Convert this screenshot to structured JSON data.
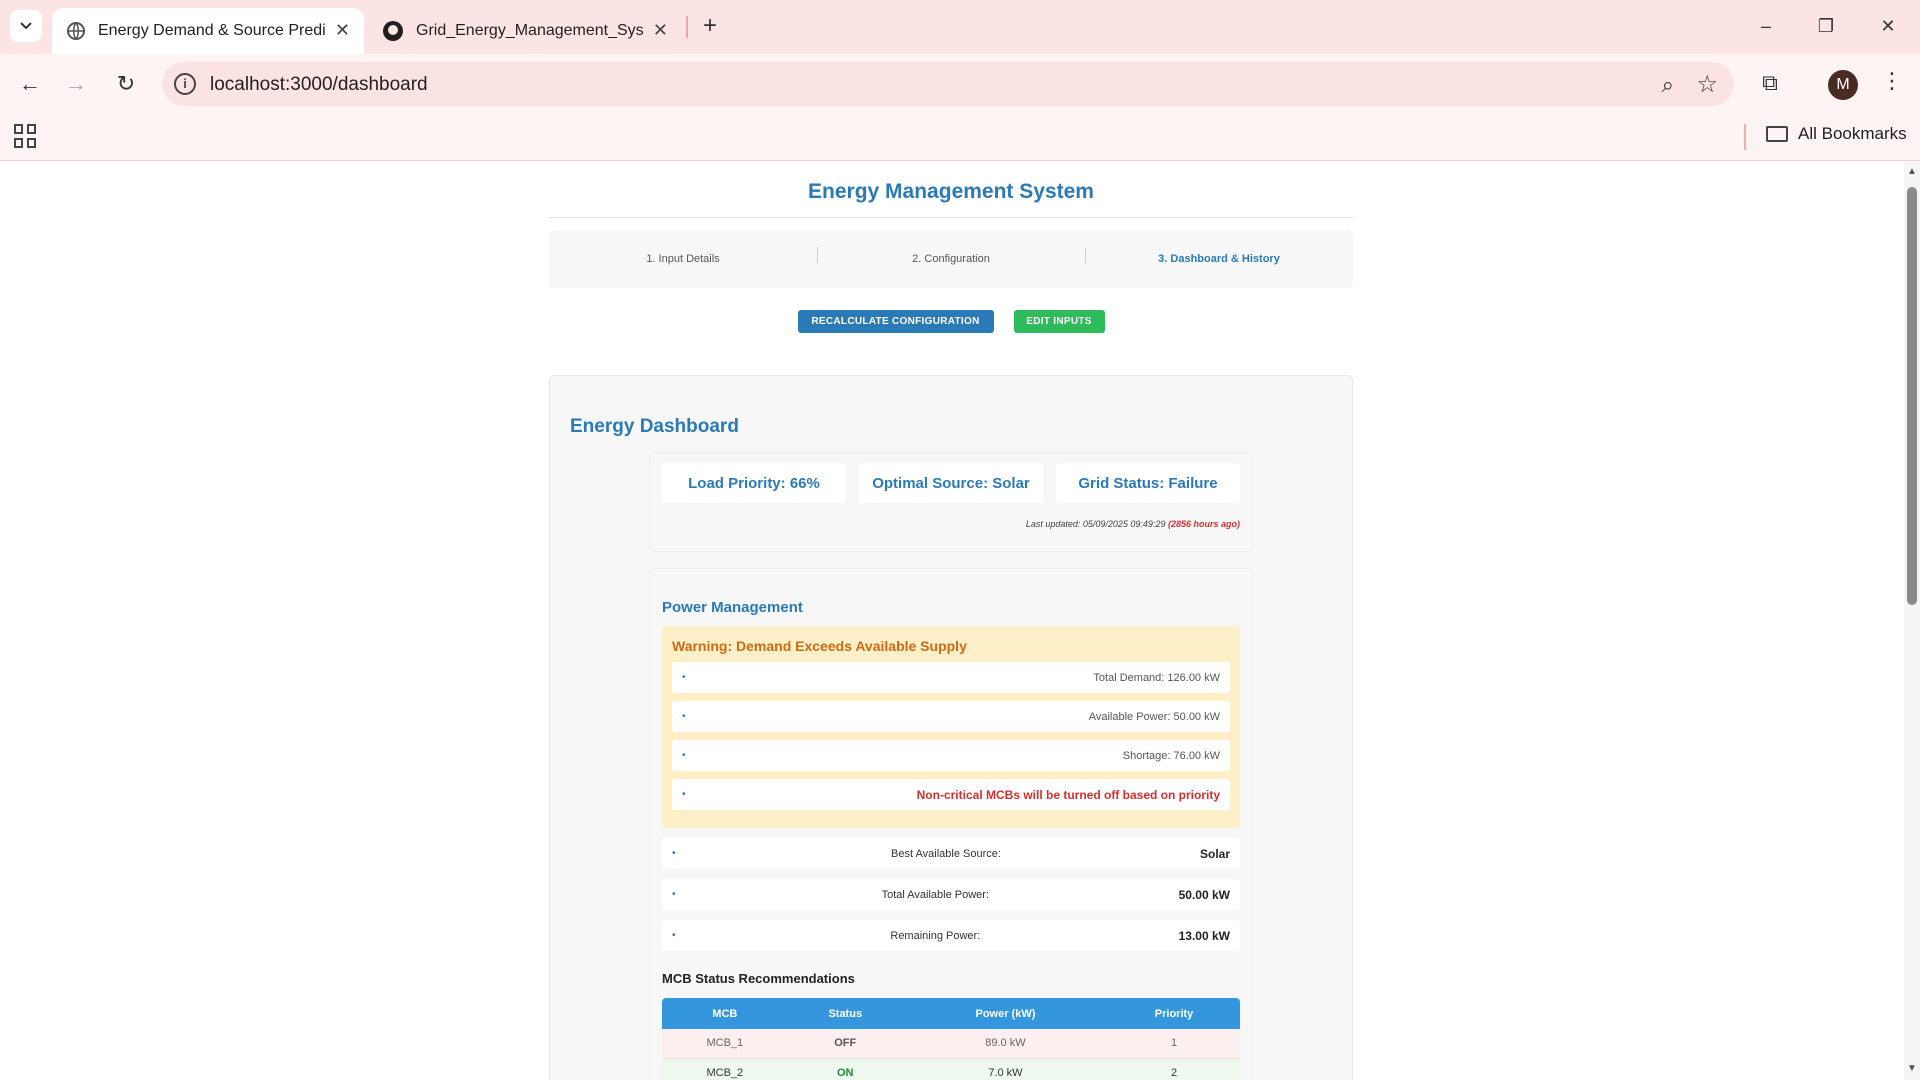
{
  "browser": {
    "tabs": [
      {
        "title": "Energy Demand & Source Predi",
        "icon": "globe-icon",
        "close": "✕"
      },
      {
        "title": "Grid_Energy_Management_Syst",
        "icon": "github-icon",
        "close": "✕"
      }
    ],
    "new_tab": "+",
    "url": "localhost:3000/dashboard",
    "avatar_letter": "M",
    "all_bookmarks": "All Bookmarks"
  },
  "app": {
    "title": "Energy Management System",
    "steps": [
      "1. Input Details",
      "2. Configuration",
      "3. Dashboard & History"
    ],
    "active_step": 2,
    "buttons": {
      "recalculate": "RECALCULATE CONFIGURATION",
      "edit": "EDIT INPUTS"
    }
  },
  "dashboard": {
    "title": "Energy Dashboard",
    "summary": {
      "load_priority": "Load Priority: 66%",
      "optimal_source": "Optimal Source: Solar",
      "grid_status": "Grid Status: Failure"
    },
    "last_updated": "Last updated: 05/09/2025 09:49:29",
    "ago": "(2856 hours ago)"
  },
  "power": {
    "title": "Power Management",
    "warning_title": "Warning: Demand Exceeds Available Supply",
    "warning_items": [
      "Total Demand: 126.00 kW",
      "Available Power: 50.00 kW",
      "Shortage: 76.00 kW",
      "Non-critical MCBs will be turned off based on priority"
    ],
    "stats": [
      {
        "label": "Best Available Source:",
        "value": "Solar"
      },
      {
        "label": "Total Available Power:",
        "value": "50.00 kW"
      },
      {
        "label": "Remaining Power:",
        "value": "13.00 kW"
      }
    ],
    "bullet": "•"
  },
  "mcb": {
    "title": "MCB Status Recommendations",
    "headers": [
      "MCB",
      "Status",
      "Power (kW)",
      "Priority"
    ],
    "rows": [
      {
        "mcb": "MCB_1",
        "status": "OFF",
        "power": "89.0 kW",
        "priority": "1"
      },
      {
        "mcb": "MCB_2",
        "status": "ON",
        "power": "7.0 kW",
        "priority": "2"
      }
    ]
  }
}
